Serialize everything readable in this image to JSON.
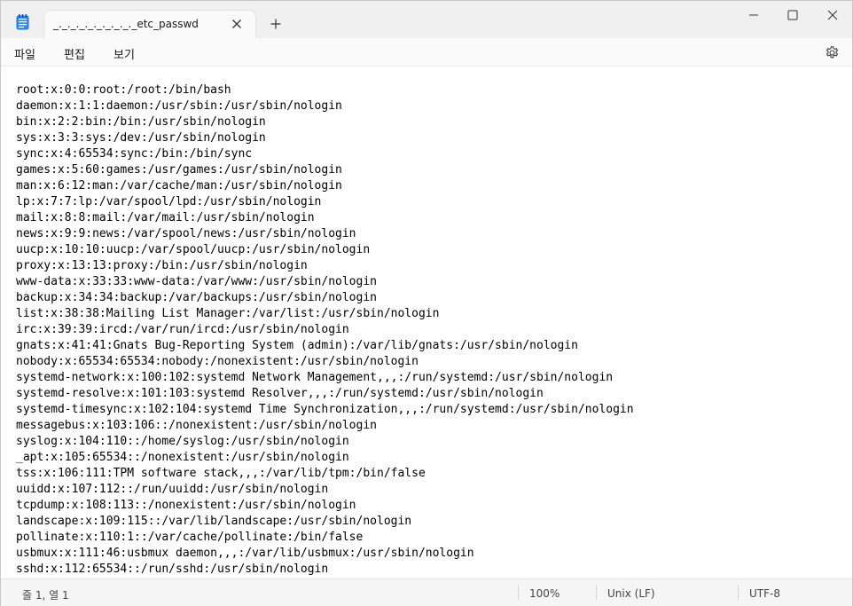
{
  "window": {
    "tab_title": "_._._._._._._._._._etc_passwd",
    "colors": {
      "titlebar": "#f0f0f0",
      "tab": "#fafafa",
      "accent": "#1f6fd1"
    }
  },
  "icons": {
    "app": "notepad-icon",
    "tab_close": "close-icon",
    "new_tab": "plus-icon",
    "minimize": "minimize-icon",
    "maximize": "maximize-icon",
    "close": "close-icon",
    "settings": "gear-icon"
  },
  "menu": {
    "file": "파일",
    "edit": "편집",
    "view": "보기"
  },
  "editor": {
    "lines": [
      "root:x:0:0:root:/root:/bin/bash",
      "daemon:x:1:1:daemon:/usr/sbin:/usr/sbin/nologin",
      "bin:x:2:2:bin:/bin:/usr/sbin/nologin",
      "sys:x:3:3:sys:/dev:/usr/sbin/nologin",
      "sync:x:4:65534:sync:/bin:/bin/sync",
      "games:x:5:60:games:/usr/games:/usr/sbin/nologin",
      "man:x:6:12:man:/var/cache/man:/usr/sbin/nologin",
      "lp:x:7:7:lp:/var/spool/lpd:/usr/sbin/nologin",
      "mail:x:8:8:mail:/var/mail:/usr/sbin/nologin",
      "news:x:9:9:news:/var/spool/news:/usr/sbin/nologin",
      "uucp:x:10:10:uucp:/var/spool/uucp:/usr/sbin/nologin",
      "proxy:x:13:13:proxy:/bin:/usr/sbin/nologin",
      "www-data:x:33:33:www-data:/var/www:/usr/sbin/nologin",
      "backup:x:34:34:backup:/var/backups:/usr/sbin/nologin",
      "list:x:38:38:Mailing List Manager:/var/list:/usr/sbin/nologin",
      "irc:x:39:39:ircd:/var/run/ircd:/usr/sbin/nologin",
      "gnats:x:41:41:Gnats Bug-Reporting System (admin):/var/lib/gnats:/usr/sbin/nologin",
      "nobody:x:65534:65534:nobody:/nonexistent:/usr/sbin/nologin",
      "systemd-network:x:100:102:systemd Network Management,,,:/run/systemd:/usr/sbin/nologin",
      "systemd-resolve:x:101:103:systemd Resolver,,,:/run/systemd:/usr/sbin/nologin",
      "systemd-timesync:x:102:104:systemd Time Synchronization,,,:/run/systemd:/usr/sbin/nologin",
      "messagebus:x:103:106::/nonexistent:/usr/sbin/nologin",
      "syslog:x:104:110::/home/syslog:/usr/sbin/nologin",
      "_apt:x:105:65534::/nonexistent:/usr/sbin/nologin",
      "tss:x:106:111:TPM software stack,,,:/var/lib/tpm:/bin/false",
      "uuidd:x:107:112::/run/uuidd:/usr/sbin/nologin",
      "tcpdump:x:108:113::/nonexistent:/usr/sbin/nologin",
      "landscape:x:109:115::/var/lib/landscape:/usr/sbin/nologin",
      "pollinate:x:110:1::/var/cache/pollinate:/bin/false",
      "usbmux:x:111:46:usbmux daemon,,,:/var/lib/usbmux:/usr/sbin/nologin",
      "sshd:x:112:65534::/run/sshd:/usr/sbin/nologin"
    ]
  },
  "status": {
    "position": "줄 1, 열 1",
    "zoom": "100%",
    "line_ending": "Unix (LF)",
    "encoding": "UTF-8"
  }
}
